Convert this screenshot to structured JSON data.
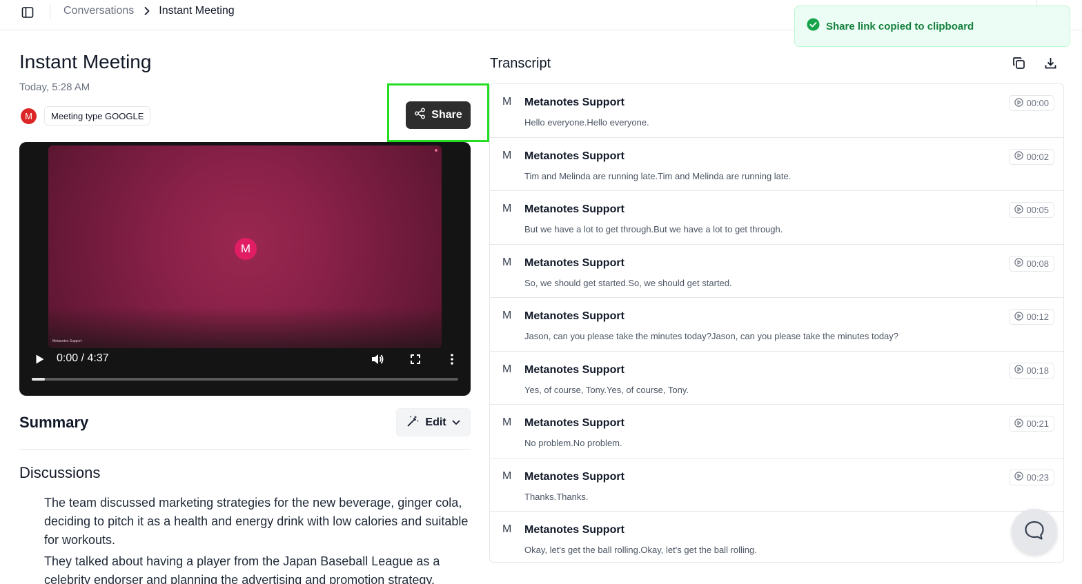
{
  "breadcrumb": {
    "parent": "Conversations",
    "current": "Instant Meeting"
  },
  "meeting": {
    "title": "Instant Meeting",
    "date": "Today, 5:28 AM",
    "avatar_initial": "M",
    "meeting_type": "Meeting type GOOGLE",
    "share_label": "Share"
  },
  "video": {
    "avatar_initial": "M",
    "caption": "Metanotes Support",
    "time": "0:00 / 4:37",
    "progress_fraction": 0.03
  },
  "summary": {
    "title": "Summary",
    "edit_label": "Edit",
    "discussions_title": "Discussions",
    "paragraphs": [
      "The team discussed marketing strategies for the new beverage, ginger cola, deciding to pitch it as a health and energy drink with low calories and suitable for workouts.",
      "They talked about having a player from the Japan Baseball League as a celebrity endorser and planning the advertising and promotion strategy."
    ]
  },
  "transcript": {
    "title": "Transcript",
    "entries": [
      {
        "initial": "M",
        "speaker": "Metanotes Support",
        "time": "00:00",
        "text": "Hello everyone.Hello everyone."
      },
      {
        "initial": "M",
        "speaker": "Metanotes Support",
        "time": "00:02",
        "text": "Tim and Melinda are running late.Tim and Melinda are running late."
      },
      {
        "initial": "M",
        "speaker": "Metanotes Support",
        "time": "00:05",
        "text": "But we have a lot to get through.But we have a lot to get through."
      },
      {
        "initial": "M",
        "speaker": "Metanotes Support",
        "time": "00:08",
        "text": "So, we should get started.So, we should get started."
      },
      {
        "initial": "M",
        "speaker": "Metanotes Support",
        "time": "00:12",
        "text": "Jason, can you please take the minutes today?Jason, can you please take the minutes today?"
      },
      {
        "initial": "M",
        "speaker": "Metanotes Support",
        "time": "00:18",
        "text": "Yes, of course, Tony.Yes, of course, Tony."
      },
      {
        "initial": "M",
        "speaker": "Metanotes Support",
        "time": "00:21",
        "text": "No problem.No problem."
      },
      {
        "initial": "M",
        "speaker": "Metanotes Support",
        "time": "00:23",
        "text": "Thanks.Thanks."
      },
      {
        "initial": "M",
        "speaker": "Metanotes Support",
        "time": "",
        "text": "Okay, let's get the ball rolling.Okay, let's get the ball rolling."
      }
    ]
  },
  "toast": {
    "message": "Share link copied to clipboard"
  },
  "colors": {
    "accent_dark": "#2d2d2d",
    "toast_green": "#15803d",
    "highlight": "#22dd22",
    "avatar_red": "#dc2626"
  }
}
